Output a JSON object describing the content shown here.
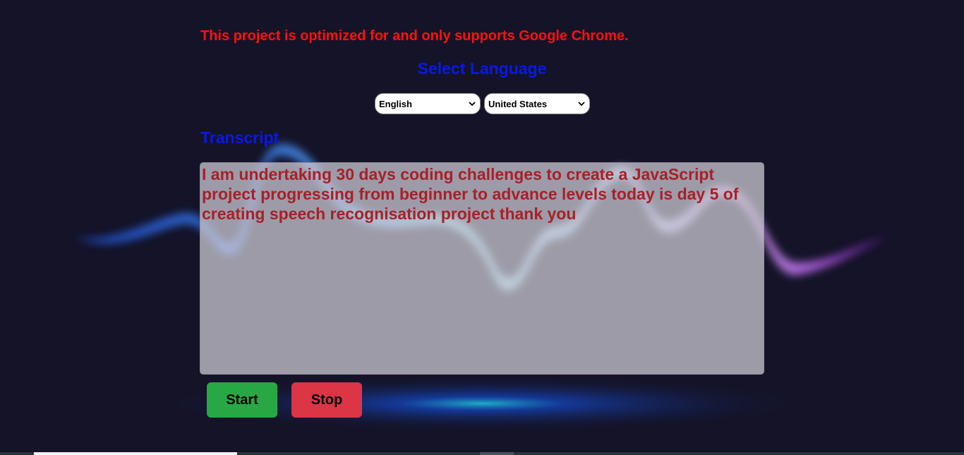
{
  "notice": "This project is optimized for and only supports Google Chrome.",
  "language_section": {
    "title": "Select Language",
    "language_value": "English",
    "dialect_value": "United States"
  },
  "transcript": {
    "title": "Transcript",
    "text": "I am undertaking 30 days coding challenges to create a JavaScript project progressing from beginner to advance levels today is day 5 of creating speech recognisation project thank you"
  },
  "buttons": {
    "start_label": "Start",
    "stop_label": "Stop"
  },
  "colors": {
    "background": "#141328",
    "notice": "#ff1010",
    "heading": "#0a18e8",
    "transcript_text": "#a82028",
    "start_button": "#27a844",
    "stop_button": "#dc3546"
  }
}
